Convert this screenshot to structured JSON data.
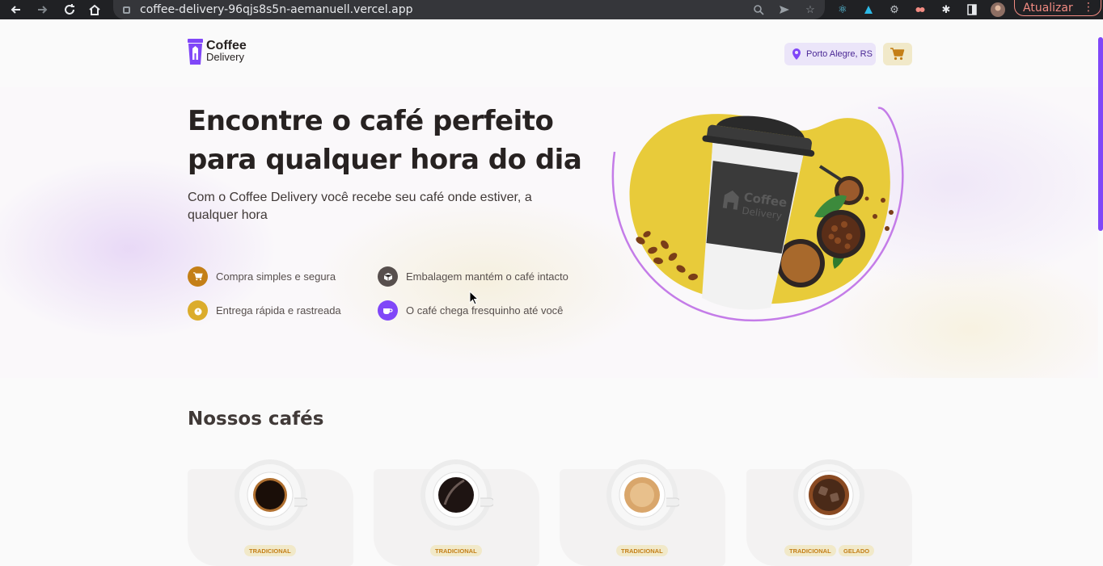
{
  "browser": {
    "url": "coffee-delivery-96qjs8s5n-aemanuell.vercel.app",
    "update_label": "Atualizar"
  },
  "header": {
    "logo_line1": "Coffee",
    "logo_line2": "Delivery",
    "location": "Porto Alegre, RS"
  },
  "hero": {
    "title": "Encontre o café perfeito para qualquer hora do dia",
    "subtitle": "Com o Coffee Delivery você recebe seu café onde estiver, a qualquer hora",
    "image_cup_brand_line1": "Coffee",
    "image_cup_brand_line2": "Delivery",
    "features": [
      {
        "label": "Compra simples e segura",
        "icon": "cart-icon",
        "color": "#C47F17"
      },
      {
        "label": "Embalagem mantém o café intacto",
        "icon": "package-icon",
        "color": "#574F4D"
      },
      {
        "label": "Entrega rápida e rastreada",
        "icon": "timer-icon",
        "color": "#DBAC2C"
      },
      {
        "label": "O café chega fresquinho até você",
        "icon": "coffee-icon",
        "color": "#8047F8"
      }
    ]
  },
  "catalog": {
    "title": "Nossos cafés",
    "cards": [
      {
        "tags": [
          "TRADICIONAL"
        ]
      },
      {
        "tags": [
          "TRADICIONAL"
        ]
      },
      {
        "tags": [
          "TRADICIONAL"
        ]
      },
      {
        "tags": [
          "TRADICIONAL",
          "GELADO"
        ]
      }
    ]
  },
  "colors": {
    "purple": "#8047F8",
    "yellow": "#DBAC2C",
    "yellow_dark": "#C47F17",
    "purple_light": "#EBE5F9",
    "yellow_light": "#F1E9C9"
  }
}
